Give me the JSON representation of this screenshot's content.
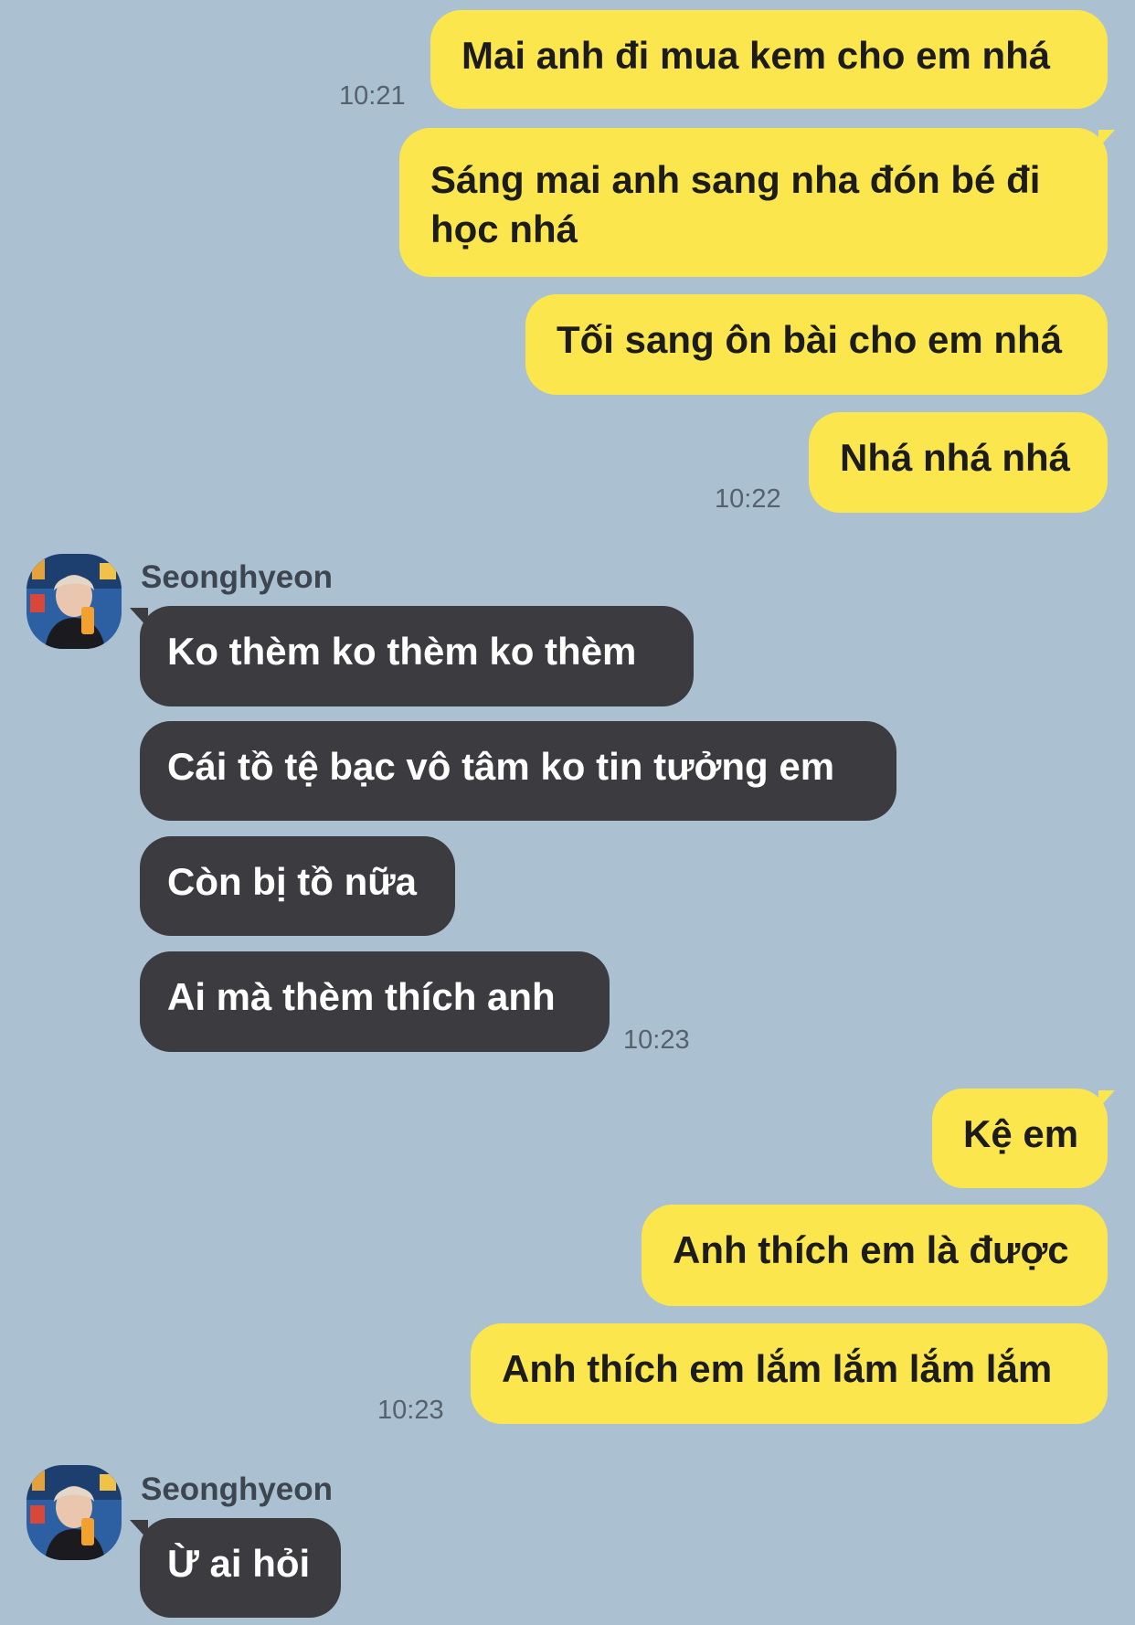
{
  "messages": [
    {
      "text": "Mai anh đi mua kem cho em nhá",
      "time": "10:21"
    },
    {
      "text": "Sáng mai anh sang nha đón bé đi học nhá"
    },
    {
      "text": "Tối sang ôn bài cho em nhá"
    },
    {
      "text": "Nhá nhá nhá",
      "time": "10:22"
    },
    {
      "sender": "Seonghyeon",
      "text": "Ko thèm ko thèm ko thèm"
    },
    {
      "text": "Cái tồ tệ bạc vô tâm ko tin tưởng em"
    },
    {
      "text": "Còn bị tồ nữa"
    },
    {
      "text": "Ai mà thèm thích anh",
      "time": "10:23"
    },
    {
      "text": "Kệ em"
    },
    {
      "text": "Anh thích em là được"
    },
    {
      "text": "Anh thích em lắm lắm lắm lắm",
      "time": "10:23"
    },
    {
      "sender": "Seonghyeon",
      "text": "Ừ ai hỏi"
    }
  ],
  "colors": {
    "background": "#abc1d1",
    "outgoing_bubble": "#fbe64d",
    "incoming_bubble": "#3c3b40"
  },
  "icons": {
    "avatar": "contact-avatar-photo"
  }
}
